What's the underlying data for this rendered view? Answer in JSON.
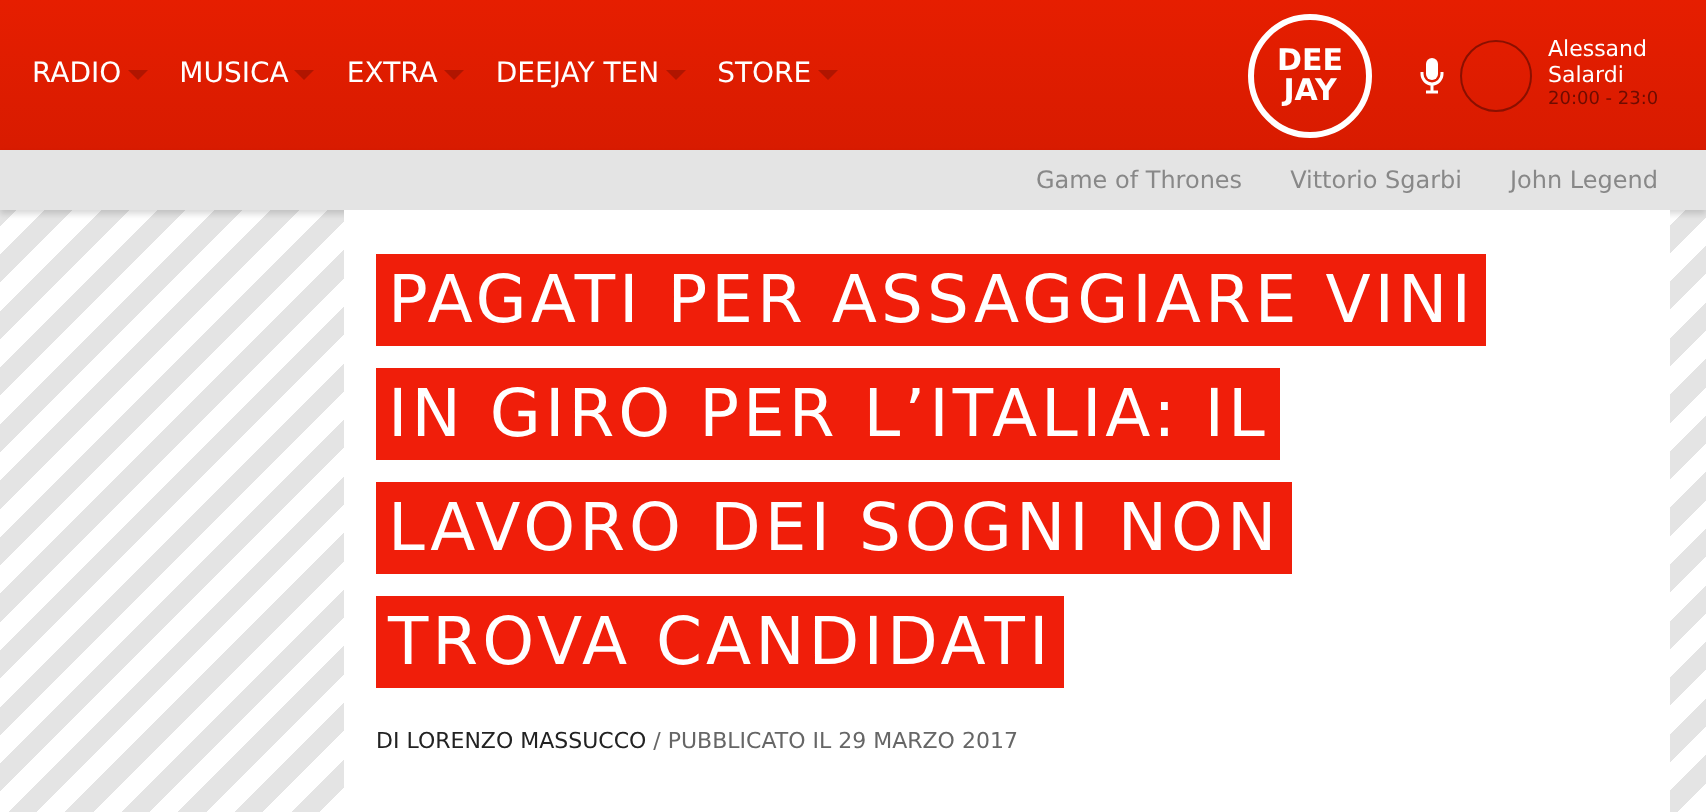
{
  "nav": {
    "items": [
      {
        "label": "RADIO"
      },
      {
        "label": "MUSICA"
      },
      {
        "label": "EXTRA"
      },
      {
        "label": "DEEJAY TEN"
      },
      {
        "label": "STORE"
      }
    ]
  },
  "logo": {
    "lines": [
      "DEE",
      "JAY"
    ]
  },
  "on_air": {
    "host_lines": [
      "Alessand",
      "Salardi"
    ],
    "time": "20:00 - 23:0"
  },
  "trending": [
    "Game of Thrones",
    "Vittorio Sgarbi",
    "John Legend"
  ],
  "article": {
    "title_lines": [
      "PAGATI PER ASSAGGIARE VINI",
      "IN GIRO PER L’ITALIA: IL",
      "LAVORO DEI SOGNI NON",
      "TROVA CANDIDATI"
    ],
    "author": "DI LORENZO MASSUCCO",
    "published": "/ PUBBLICATO IL 29 MARZO 2017"
  }
}
